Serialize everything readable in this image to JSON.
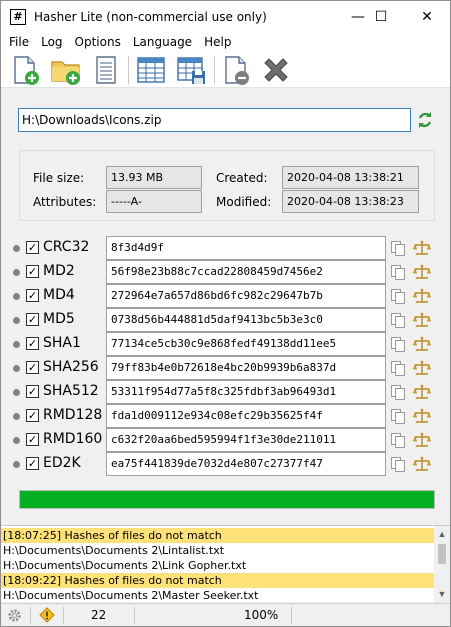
{
  "window": {
    "title": "Hasher Lite (non-commercial use only)",
    "icon_char": "#",
    "controls": {
      "minimize": "—",
      "maximize": "☐",
      "close": "✕"
    }
  },
  "menu": [
    "File",
    "Log",
    "Options",
    "Language",
    "Help"
  ],
  "toolbar": {
    "buttons": [
      "add-file-icon",
      "add-folder-icon",
      "text-document-icon",
      "table-icon",
      "table-save-icon",
      "remove-document-icon",
      "clear-x-icon"
    ]
  },
  "path": {
    "value": "H:\\Downloads\\Icons.zip"
  },
  "file_info": {
    "size_label": "File size:",
    "size_value": "13.93 MB",
    "attr_label": "Attributes:",
    "attr_value": "-----A-",
    "created_label": "Created:",
    "created_value": "2020-04-08 13:38:21",
    "modified_label": "Modified:",
    "modified_value": "2020-04-08 13:38:23"
  },
  "hashes": [
    {
      "name": "CRC32",
      "value": "8f3d4d9f",
      "checked": true
    },
    {
      "name": "MD2",
      "value": "56f98e23b88c7ccad22808459d7456e2",
      "checked": true
    },
    {
      "name": "MD4",
      "value": "272964e7a657d86bd6fc982c29647b7b",
      "checked": true
    },
    {
      "name": "MD5",
      "value": "0738d56b444881d5daf9413bc5b3e3c0",
      "checked": true
    },
    {
      "name": "SHA1",
      "value": "77134ce5cb30c9e868fedf49138dd11ee5",
      "checked": true
    },
    {
      "name": "SHA256",
      "value": "79ff83b4e0b72618e4bc20b9939b6a837d",
      "checked": true
    },
    {
      "name": "SHA512",
      "value": "53311f954d77a5f8c325fdbf3ab96493d1",
      "checked": true
    },
    {
      "name": "RMD128",
      "value": "fda1d009112e934c08efc29b35625f4f",
      "checked": true
    },
    {
      "name": "RMD160",
      "value": "c632f20aa6bed595994f1f3e30de211011",
      "checked": true
    },
    {
      "name": "ED2K",
      "value": "ea75f441839de7032d4e807c27377f47",
      "checked": true
    }
  ],
  "progress": {
    "fraction": 1.0
  },
  "log": [
    {
      "text": "[18:07:25] Hashes of files do not match",
      "warn": true
    },
    {
      "text": "H:\\Documents\\Documents 2\\Lintalist.txt",
      "warn": false
    },
    {
      "text": "H:\\Documents\\Documents 2\\Link Gopher.txt",
      "warn": false
    },
    {
      "text": "[18:09:22] Hashes of files do not match",
      "warn": true
    },
    {
      "text": "H:\\Documents\\Documents 2\\Master Seeker.txt",
      "warn": false
    }
  ],
  "status": {
    "count": "22",
    "zoom": "100%"
  },
  "colors": {
    "accent": "#3c7fb1",
    "progress": "#06b025",
    "warning": "#ffe17a"
  }
}
